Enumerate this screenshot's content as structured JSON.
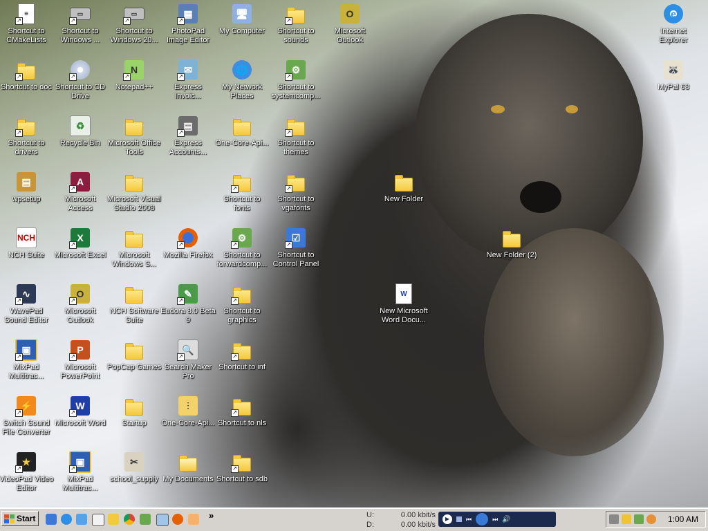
{
  "desktop": {
    "icons": [
      {
        "label": "Shortcut to CMakeLists",
        "kind": "doc",
        "short": true,
        "col": 0,
        "row": 0
      },
      {
        "label": "Shortcut to doc",
        "kind": "folder",
        "short": true,
        "col": 0,
        "row": 1
      },
      {
        "label": "Shortcut to drivers",
        "kind": "folder",
        "short": true,
        "col": 0,
        "row": 2
      },
      {
        "label": "wpsetup",
        "kind": "setup",
        "short": false,
        "col": 0,
        "row": 3
      },
      {
        "label": "NCH Suite",
        "kind": "nch",
        "short": false,
        "col": 0,
        "row": 4
      },
      {
        "label": "WavePad Sound Editor",
        "kind": "wave",
        "short": true,
        "col": 0,
        "row": 5
      },
      {
        "label": "MixPad Multitrac...",
        "kind": "mix",
        "short": true,
        "col": 0,
        "row": 6
      },
      {
        "label": "Switch Sound File Converter",
        "kind": "switch",
        "short": true,
        "col": 0,
        "row": 7
      },
      {
        "label": "VideoPad Video Editor",
        "kind": "video",
        "short": true,
        "col": 0,
        "row": 8
      },
      {
        "label": "Shortcut to Windows ...",
        "kind": "drive",
        "short": true,
        "col": 1,
        "row": 0
      },
      {
        "label": "Shortcut to CD Drive",
        "kind": "cd",
        "short": true,
        "col": 1,
        "row": 1
      },
      {
        "label": "Recycle Bin",
        "kind": "recycle",
        "short": false,
        "col": 1,
        "row": 2
      },
      {
        "label": "Microsoft Access",
        "kind": "access",
        "short": true,
        "col": 1,
        "row": 3
      },
      {
        "label": "Microsoft Excel",
        "kind": "excel",
        "short": true,
        "col": 1,
        "row": 4
      },
      {
        "label": "Microsoft Outlook",
        "kind": "outlook",
        "short": true,
        "col": 1,
        "row": 5
      },
      {
        "label": "Microsoft PowerPoint",
        "kind": "ppt",
        "short": true,
        "col": 1,
        "row": 6
      },
      {
        "label": "Microsoft Word",
        "kind": "word",
        "short": true,
        "col": 1,
        "row": 7
      },
      {
        "label": "MixPad Multitrac...",
        "kind": "mix",
        "short": true,
        "col": 1,
        "row": 8
      },
      {
        "label": "Shortcut to Windows 20...",
        "kind": "drive",
        "short": true,
        "col": 2,
        "row": 0
      },
      {
        "label": "Notepad++",
        "kind": "notepad",
        "short": true,
        "col": 2,
        "row": 1
      },
      {
        "label": "Microsoft Office Tools",
        "kind": "folder",
        "short": false,
        "col": 2,
        "row": 2
      },
      {
        "label": "Microsoft Visual Studio 2008",
        "kind": "folder",
        "short": false,
        "col": 2,
        "row": 3
      },
      {
        "label": "Microsoft Windows S...",
        "kind": "folder",
        "short": false,
        "col": 2,
        "row": 4
      },
      {
        "label": "NCH Software Suite",
        "kind": "folder",
        "short": false,
        "col": 2,
        "row": 5
      },
      {
        "label": "PopCap Games",
        "kind": "folder",
        "short": false,
        "col": 2,
        "row": 6
      },
      {
        "label": "Startup",
        "kind": "folder",
        "short": false,
        "col": 2,
        "row": 7
      },
      {
        "label": "school_supply",
        "kind": "school",
        "short": false,
        "col": 2,
        "row": 8
      },
      {
        "label": "PhotoPad Image Editor",
        "kind": "photo",
        "short": true,
        "col": 3,
        "row": 0
      },
      {
        "label": "Express Invoic...",
        "kind": "invoice",
        "short": true,
        "col": 3,
        "row": 1
      },
      {
        "label": "Express Accounts...",
        "kind": "accounts",
        "short": true,
        "col": 3,
        "row": 2
      },
      {
        "label": "Mozilla Firefox",
        "kind": "firefox",
        "short": true,
        "col": 3,
        "row": 4
      },
      {
        "label": "Eudora 8.0 Beta 9",
        "kind": "eudora",
        "short": true,
        "col": 3,
        "row": 5
      },
      {
        "label": "Search Maker Pro",
        "kind": "search",
        "short": true,
        "col": 3,
        "row": 6
      },
      {
        "label": "One-Core-Api...",
        "kind": "zip",
        "short": false,
        "col": 3,
        "row": 7
      },
      {
        "label": "My Documents",
        "kind": "mydocs",
        "short": false,
        "col": 3,
        "row": 8
      },
      {
        "label": "My Computer",
        "kind": "computer",
        "short": false,
        "col": 4,
        "row": 0
      },
      {
        "label": "My Network Places",
        "kind": "network",
        "short": false,
        "col": 4,
        "row": 1
      },
      {
        "label": "One-Core-Api...",
        "kind": "folder",
        "short": false,
        "col": 4,
        "row": 2
      },
      {
        "label": "Shortcut to fonts",
        "kind": "folder",
        "short": true,
        "col": 4,
        "row": 3
      },
      {
        "label": "Shortcut to forwardcomp...",
        "kind": "gear",
        "short": true,
        "col": 4,
        "row": 4
      },
      {
        "label": "Shortcut to graphics",
        "kind": "folder",
        "short": true,
        "col": 4,
        "row": 5
      },
      {
        "label": "Shortcut to inf",
        "kind": "folder",
        "short": true,
        "col": 4,
        "row": 6
      },
      {
        "label": "Shortcut to nls",
        "kind": "folder",
        "short": true,
        "col": 4,
        "row": 7
      },
      {
        "label": "Shortcut to sdb",
        "kind": "folder",
        "short": true,
        "col": 4,
        "row": 8
      },
      {
        "label": "Shortcut to sounds",
        "kind": "folder",
        "short": true,
        "col": 5,
        "row": 0
      },
      {
        "label": "Shortcut to systemcomp...",
        "kind": "gear",
        "short": true,
        "col": 5,
        "row": 1
      },
      {
        "label": "Shortcut to themes",
        "kind": "folder",
        "short": true,
        "col": 5,
        "row": 2
      },
      {
        "label": "Shortcut to vgafonts",
        "kind": "folder",
        "short": true,
        "col": 5,
        "row": 3
      },
      {
        "label": "Shortcut to Control Panel",
        "kind": "control",
        "short": true,
        "col": 5,
        "row": 4
      },
      {
        "label": "Microsoft Outlook",
        "kind": "outlook",
        "short": false,
        "col": 6,
        "row": 0
      },
      {
        "label": "New Folder",
        "kind": "folder",
        "short": false,
        "col": 7,
        "row": 3
      },
      {
        "label": "New Microsoft Word Docu...",
        "kind": "worddoc",
        "short": false,
        "col": 7,
        "row": 5
      },
      {
        "label": "New Folder (2)",
        "kind": "folder",
        "short": false,
        "col": 9,
        "row": 4
      },
      {
        "label": "Internet Explorer",
        "kind": "ie",
        "short": false,
        "col": 12,
        "row": 0
      },
      {
        "label": "MyPal 68",
        "kind": "mypal",
        "short": false,
        "col": 12,
        "row": 1
      }
    ]
  },
  "taskbar": {
    "start_label": "Start",
    "overflow": "»",
    "net": {
      "up_label": "U:",
      "up_value": "0.00 kbit/s",
      "down_label": "D:",
      "down_value": "0.00 kbit/s"
    },
    "clock": "1:00 AM"
  }
}
